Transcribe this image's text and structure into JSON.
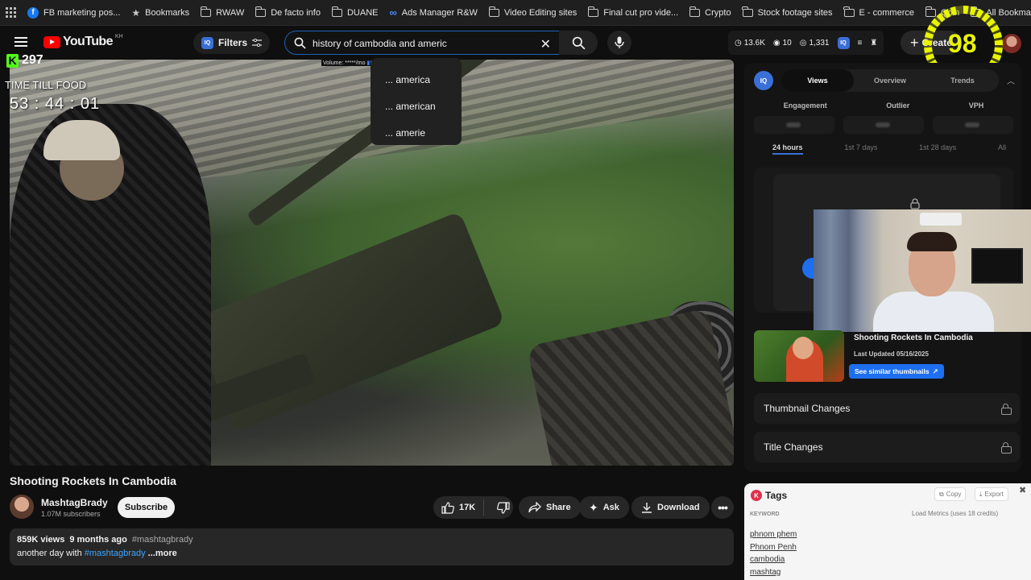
{
  "bookmarks": [
    {
      "label": "FB marketing pos...",
      "icon": "facebook-icon"
    },
    {
      "label": "Bookmarks",
      "icon": "star-icon"
    },
    {
      "label": "RWAW",
      "icon": "folder-icon"
    },
    {
      "label": "De facto info",
      "icon": "folder-icon"
    },
    {
      "label": "DUANE",
      "icon": "folder-icon"
    },
    {
      "label": "Ads Manager R&W",
      "icon": "meta-icon"
    },
    {
      "label": "Video Editing sites",
      "icon": "folder-icon"
    },
    {
      "label": "Final cut pro vide...",
      "icon": "folder-icon"
    },
    {
      "label": "Crypto",
      "icon": "folder-icon"
    },
    {
      "label": "Stock footage sites",
      "icon": "folder-icon"
    },
    {
      "label": "E - commerce",
      "icon": "folder-icon"
    },
    {
      "label": "Qoin",
      "icon": "folder-icon"
    },
    {
      "label": "All Bookmarks",
      "icon": "folder-icon"
    }
  ],
  "masthead": {
    "logo_text": "YouTube",
    "country_code": "KH",
    "filters_label": "Filters",
    "iq_label": "IQ",
    "search_value": "history of cambodia and americ",
    "volume_hint": "Volume: *****/mo",
    "stats": {
      "views": "13.6K",
      "count2": "10",
      "count3": "1,331"
    },
    "create_label": "Create"
  },
  "suggestions": [
    "... america",
    "... american",
    "... amerie"
  ],
  "overlay": {
    "kick_count": "297",
    "timer_label": "TIME TILL FOOD",
    "timer_value": "53 : 44 : 01",
    "gauge_value": "98",
    "gauge_level": 0.98,
    "accent": "#e9f500"
  },
  "video": {
    "title": "Shooting Rockets In Cambodia",
    "channel": "MashtagBrady",
    "subscribers": "1.07M subscribers",
    "subscribe_label": "Subscribe",
    "likes": "17K",
    "share_label": "Share",
    "ask_label": "Ask",
    "download_label": "Download",
    "description": {
      "views": "859K views",
      "age": "9 months ago",
      "hashtag": "#mashtagbrady",
      "text_prefix": "another day with",
      "text_link": "#mashtagbrady",
      "more": "...more"
    }
  },
  "panel": {
    "tabs": [
      "Views",
      "Overview",
      "Trends"
    ],
    "metrics": [
      "Engagement",
      "Outlier",
      "VPH"
    ],
    "ranges": [
      "24 hours",
      "1st 7 days",
      "1st 28 days",
      "All"
    ],
    "thumb_title": "Shooting Rockets In Cambodia",
    "thumb_updated": "Last Updated 05/16/2025",
    "see_similar": "See similar thumbnails",
    "thumbnail_changes": "Thumbnail Changes",
    "title_changes": "Title Changes"
  },
  "tags": {
    "heading": "Tags",
    "copy_label": "Copy",
    "export_label": "Export",
    "keyword_label": "KEYWORD",
    "load_metrics": "Load Metrics (uses 18 credits)",
    "items": [
      "phnom phem",
      "Phnom Penh",
      "cambodia",
      "mashtag"
    ]
  },
  "colors": {
    "brand_red": "#ff0000",
    "link_blue": "#3ea6ff",
    "button_blue": "#1e6ff0"
  }
}
